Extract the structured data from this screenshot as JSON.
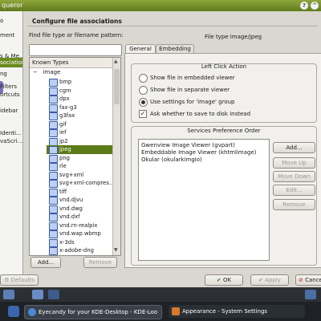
{
  "window": {
    "title": "Konqueror",
    "title_visible": "queror",
    "buttons": [
      "?",
      "^",
      "x"
    ]
  },
  "sidebar": {
    "items": [
      {
        "label": "o"
      },
      {
        "label": "ment"
      },
      {
        "label": "s & Me..."
      },
      {
        "label": "sociations",
        "selected": true
      },
      {
        "label": "ng"
      },
      {
        "label": "Filters"
      },
      {
        "label": "ortcuts"
      },
      {
        "label": "idebar"
      },
      {
        "label": "Identi..."
      },
      {
        "label": "vaScri..."
      }
    ]
  },
  "header": {
    "title": "Configure file associations"
  },
  "find": {
    "label": "Find file type or filename pattern:",
    "placeholder": "",
    "value": ""
  },
  "tree": {
    "header": "Known Types",
    "root": "image",
    "items": [
      {
        "label": "bmp"
      },
      {
        "label": "cgm"
      },
      {
        "label": "dpx"
      },
      {
        "label": "fax-g3"
      },
      {
        "label": "g3fax"
      },
      {
        "label": "gif"
      },
      {
        "label": "ief"
      },
      {
        "label": "jp2"
      },
      {
        "label": "jpeg",
        "selected": true
      },
      {
        "label": "png"
      },
      {
        "label": "rle"
      },
      {
        "label": "svg+xml"
      },
      {
        "label": "svg+xml-compres..."
      },
      {
        "label": "tiff"
      },
      {
        "label": "vnd.djvu"
      },
      {
        "label": "vnd.dwg"
      },
      {
        "label": "vnd.dxf"
      },
      {
        "label": "vnd.rn-realpix"
      },
      {
        "label": "vnd.wap.wbmp"
      },
      {
        "label": "x-3ds"
      },
      {
        "label": "x-adobe-dng"
      }
    ]
  },
  "tree_buttons": {
    "add": "Add...",
    "remove": "Remove"
  },
  "detail": {
    "file_type": "File type image/jpeg",
    "tabs": [
      {
        "label": "General",
        "active": true
      },
      {
        "label": "Embedding",
        "active": false
      }
    ],
    "left_click": {
      "title": "Left Click Action",
      "options": [
        {
          "label": "Show file in embedded viewer",
          "selected": false
        },
        {
          "label": "Show file in separate viewer",
          "selected": false
        },
        {
          "label": "Use settings for 'image' group",
          "selected": true
        }
      ],
      "ask_label": "Ask whether to save to disk instead",
      "ask_checked": true
    },
    "services": {
      "title": "Services Preference Order",
      "items": [
        "Gwenview Image Viewer (gvpart)",
        "Embeddable Image Viewer (khtmlimage)",
        "Okular (okularkimgio)"
      ],
      "buttons": [
        {
          "label": "Add...",
          "enabled": true
        },
        {
          "label": "Move Up",
          "enabled": false
        },
        {
          "label": "Move Down",
          "enabled": false
        },
        {
          "label": "Edit...",
          "enabled": false
        },
        {
          "label": "Remove",
          "enabled": false
        }
      ]
    }
  },
  "dialog_buttons": {
    "defaults": "Defaults",
    "ok": "OK",
    "apply": "Apply",
    "cancel": "Cancel"
  },
  "taskbar": {
    "tasks": [
      {
        "label": "Eyecandy for your KDE-Desktop - KDE-Loo"
      },
      {
        "label": "Appearance - System Settings"
      }
    ]
  },
  "colors": {
    "accent": "#5a7b18",
    "titlebar": "#6f8c26",
    "taskbar": "#1e2226"
  }
}
